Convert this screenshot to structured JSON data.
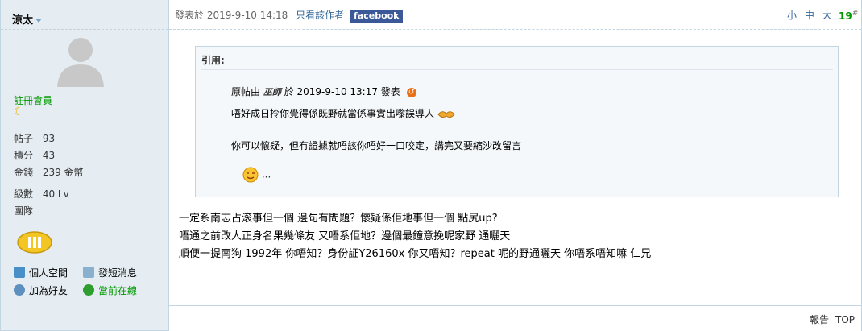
{
  "user": {
    "name": "涼太",
    "group": "註冊會員",
    "stats": [
      {
        "label": "帖子",
        "value": "93"
      },
      {
        "label": "積分",
        "value": "43"
      },
      {
        "label": "金錢",
        "value": "239 金幣"
      }
    ],
    "level": {
      "label": "級數",
      "value": "40 Lv"
    },
    "team": {
      "label": "團隊",
      "value": ""
    },
    "links": {
      "space": "個人空間",
      "message": "發短消息",
      "add_friend": "加為好友",
      "online": "當前在線"
    }
  },
  "post": {
    "posted_on": "發表於 2019-9-10 14:18",
    "only_author": "只看該作者",
    "facebook": "facebook",
    "font_sizes": "小 中 大",
    "floor": "19",
    "floor_suffix": "#",
    "quote": {
      "header": "引用:",
      "source_prefix": "原帖由",
      "source_author": "巫師",
      "source_mid": "於 2019-9-10 13:17 發表",
      "line1": "唔好成日拎你覺得係既野就當係事實出嚟誤導人",
      "line2": "你可以懷疑，但冇證據就唔該你唔好一口咬定，講完又要縮沙改留言",
      "line3": "..."
    },
    "body_lines": [
      "一定系南志占滚事但一個 邊句有問題？懷疑係佢地事但一個 點尻up?",
      "唔通之前改人正身名果幾條友 又唔系佢地？邊個最鐘意挽呢家野 通曬天",
      "順便一提南狗 1992年 你唔知？身份証Y26160x 你又唔知？repeat 呢的野通曬天 你唔系唔知嘛 仁兄"
    ],
    "actions": {
      "report": "報告",
      "top": "TOP"
    }
  },
  "colors": {
    "sidebar_bg": "#e5edf2",
    "border": "#c2d5e3",
    "green": "#009900",
    "link": "#336699",
    "facebook": "#3b5998"
  }
}
